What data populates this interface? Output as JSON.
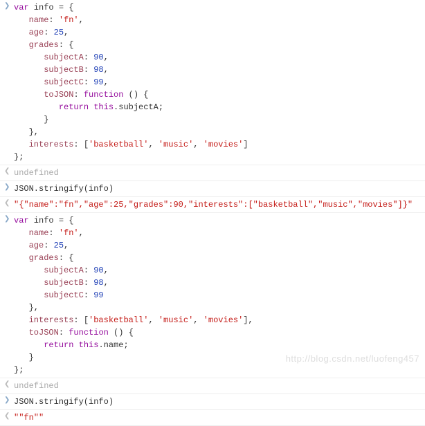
{
  "entries": [
    {
      "type": "input",
      "lines": [
        {
          "segments": [
            {
              "cls": "kw",
              "t": "var"
            },
            {
              "cls": "plain",
              "t": " info = {"
            }
          ]
        },
        {
          "indent": "   ",
          "segments": [
            {
              "cls": "key",
              "t": "name"
            },
            {
              "cls": "plain",
              "t": ": "
            },
            {
              "cls": "str",
              "t": "'fn'"
            },
            {
              "cls": "plain",
              "t": ","
            }
          ]
        },
        {
          "indent": "   ",
          "segments": [
            {
              "cls": "key",
              "t": "age"
            },
            {
              "cls": "plain",
              "t": ": "
            },
            {
              "cls": "num",
              "t": "25"
            },
            {
              "cls": "plain",
              "t": ","
            }
          ]
        },
        {
          "indent": "   ",
          "segments": [
            {
              "cls": "key",
              "t": "grades"
            },
            {
              "cls": "plain",
              "t": ": {"
            }
          ]
        },
        {
          "indent": "      ",
          "segments": [
            {
              "cls": "key",
              "t": "subjectA"
            },
            {
              "cls": "plain",
              "t": ": "
            },
            {
              "cls": "num",
              "t": "90"
            },
            {
              "cls": "plain",
              "t": ","
            }
          ]
        },
        {
          "indent": "      ",
          "segments": [
            {
              "cls": "key",
              "t": "subjectB"
            },
            {
              "cls": "plain",
              "t": ": "
            },
            {
              "cls": "num",
              "t": "98"
            },
            {
              "cls": "plain",
              "t": ","
            }
          ]
        },
        {
          "indent": "      ",
          "segments": [
            {
              "cls": "key",
              "t": "subjectC"
            },
            {
              "cls": "plain",
              "t": ": "
            },
            {
              "cls": "num",
              "t": "99"
            },
            {
              "cls": "plain",
              "t": ","
            }
          ]
        },
        {
          "indent": "      ",
          "segments": [
            {
              "cls": "key",
              "t": "toJSON"
            },
            {
              "cls": "plain",
              "t": ": "
            },
            {
              "cls": "kw",
              "t": "function"
            },
            {
              "cls": "plain",
              "t": " () {"
            }
          ]
        },
        {
          "indent": "         ",
          "segments": [
            {
              "cls": "kw",
              "t": "return"
            },
            {
              "cls": "plain",
              "t": " "
            },
            {
              "cls": "kw",
              "t": "this"
            },
            {
              "cls": "plain",
              "t": ".subjectA;"
            }
          ]
        },
        {
          "indent": "      ",
          "segments": [
            {
              "cls": "plain",
              "t": "}"
            }
          ]
        },
        {
          "indent": "   ",
          "segments": [
            {
              "cls": "plain",
              "t": "},"
            }
          ]
        },
        {
          "indent": "   ",
          "segments": [
            {
              "cls": "key",
              "t": "interests"
            },
            {
              "cls": "plain",
              "t": ": ["
            },
            {
              "cls": "str",
              "t": "'basketball'"
            },
            {
              "cls": "plain",
              "t": ", "
            },
            {
              "cls": "str",
              "t": "'music'"
            },
            {
              "cls": "plain",
              "t": ", "
            },
            {
              "cls": "str",
              "t": "'movies'"
            },
            {
              "cls": "plain",
              "t": "]"
            }
          ]
        },
        {
          "segments": [
            {
              "cls": "plain",
              "t": "};"
            }
          ]
        }
      ]
    },
    {
      "type": "output",
      "lines": [
        {
          "segments": [
            {
              "cls": "undef",
              "t": "undefined"
            }
          ]
        }
      ]
    },
    {
      "type": "input",
      "lines": [
        {
          "segments": [
            {
              "cls": "plain",
              "t": "JSON.stringify(info)"
            }
          ]
        }
      ]
    },
    {
      "type": "output",
      "lines": [
        {
          "segments": [
            {
              "cls": "result-str",
              "t": "\"{\"name\":\"fn\",\"age\":25,\"grades\":90,\"interests\":[\"basketball\",\"music\",\"movies\"]}\""
            }
          ]
        }
      ]
    },
    {
      "type": "input",
      "lines": [
        {
          "segments": [
            {
              "cls": "kw",
              "t": "var"
            },
            {
              "cls": "plain",
              "t": " info = {"
            }
          ]
        },
        {
          "indent": "   ",
          "segments": [
            {
              "cls": "key",
              "t": "name"
            },
            {
              "cls": "plain",
              "t": ": "
            },
            {
              "cls": "str",
              "t": "'fn'"
            },
            {
              "cls": "plain",
              "t": ","
            }
          ]
        },
        {
          "indent": "   ",
          "segments": [
            {
              "cls": "key",
              "t": "age"
            },
            {
              "cls": "plain",
              "t": ": "
            },
            {
              "cls": "num",
              "t": "25"
            },
            {
              "cls": "plain",
              "t": ","
            }
          ]
        },
        {
          "indent": "   ",
          "segments": [
            {
              "cls": "key",
              "t": "grades"
            },
            {
              "cls": "plain",
              "t": ": {"
            }
          ]
        },
        {
          "indent": "      ",
          "segments": [
            {
              "cls": "key",
              "t": "subjectA"
            },
            {
              "cls": "plain",
              "t": ": "
            },
            {
              "cls": "num",
              "t": "90"
            },
            {
              "cls": "plain",
              "t": ","
            }
          ]
        },
        {
          "indent": "      ",
          "segments": [
            {
              "cls": "key",
              "t": "subjectB"
            },
            {
              "cls": "plain",
              "t": ": "
            },
            {
              "cls": "num",
              "t": "98"
            },
            {
              "cls": "plain",
              "t": ","
            }
          ]
        },
        {
          "indent": "      ",
          "segments": [
            {
              "cls": "key",
              "t": "subjectC"
            },
            {
              "cls": "plain",
              "t": ": "
            },
            {
              "cls": "num",
              "t": "99"
            }
          ]
        },
        {
          "indent": "   ",
          "segments": [
            {
              "cls": "plain",
              "t": "},"
            }
          ]
        },
        {
          "indent": "   ",
          "segments": [
            {
              "cls": "key",
              "t": "interests"
            },
            {
              "cls": "plain",
              "t": ": ["
            },
            {
              "cls": "str",
              "t": "'basketball'"
            },
            {
              "cls": "plain",
              "t": ", "
            },
            {
              "cls": "str",
              "t": "'music'"
            },
            {
              "cls": "plain",
              "t": ", "
            },
            {
              "cls": "str",
              "t": "'movies'"
            },
            {
              "cls": "plain",
              "t": "],"
            }
          ]
        },
        {
          "indent": "   ",
          "segments": [
            {
              "cls": "key",
              "t": "toJSON"
            },
            {
              "cls": "plain",
              "t": ": "
            },
            {
              "cls": "kw",
              "t": "function"
            },
            {
              "cls": "plain",
              "t": " () {"
            }
          ]
        },
        {
          "indent": "      ",
          "segments": [
            {
              "cls": "kw",
              "t": "return"
            },
            {
              "cls": "plain",
              "t": " "
            },
            {
              "cls": "kw",
              "t": "this"
            },
            {
              "cls": "plain",
              "t": ".name;"
            }
          ]
        },
        {
          "indent": "   ",
          "segments": [
            {
              "cls": "plain",
              "t": "}"
            }
          ]
        },
        {
          "segments": [
            {
              "cls": "plain",
              "t": "};"
            }
          ]
        }
      ]
    },
    {
      "type": "output",
      "lines": [
        {
          "segments": [
            {
              "cls": "undef",
              "t": "undefined"
            }
          ]
        }
      ]
    },
    {
      "type": "input",
      "lines": [
        {
          "segments": [
            {
              "cls": "plain",
              "t": "JSON.stringify(info)"
            }
          ]
        }
      ]
    },
    {
      "type": "output",
      "lines": [
        {
          "segments": [
            {
              "cls": "result-str",
              "t": "\"\"fn\"\""
            }
          ]
        }
      ]
    }
  ],
  "watermark": "http://blog.csdn.net/luofeng457"
}
